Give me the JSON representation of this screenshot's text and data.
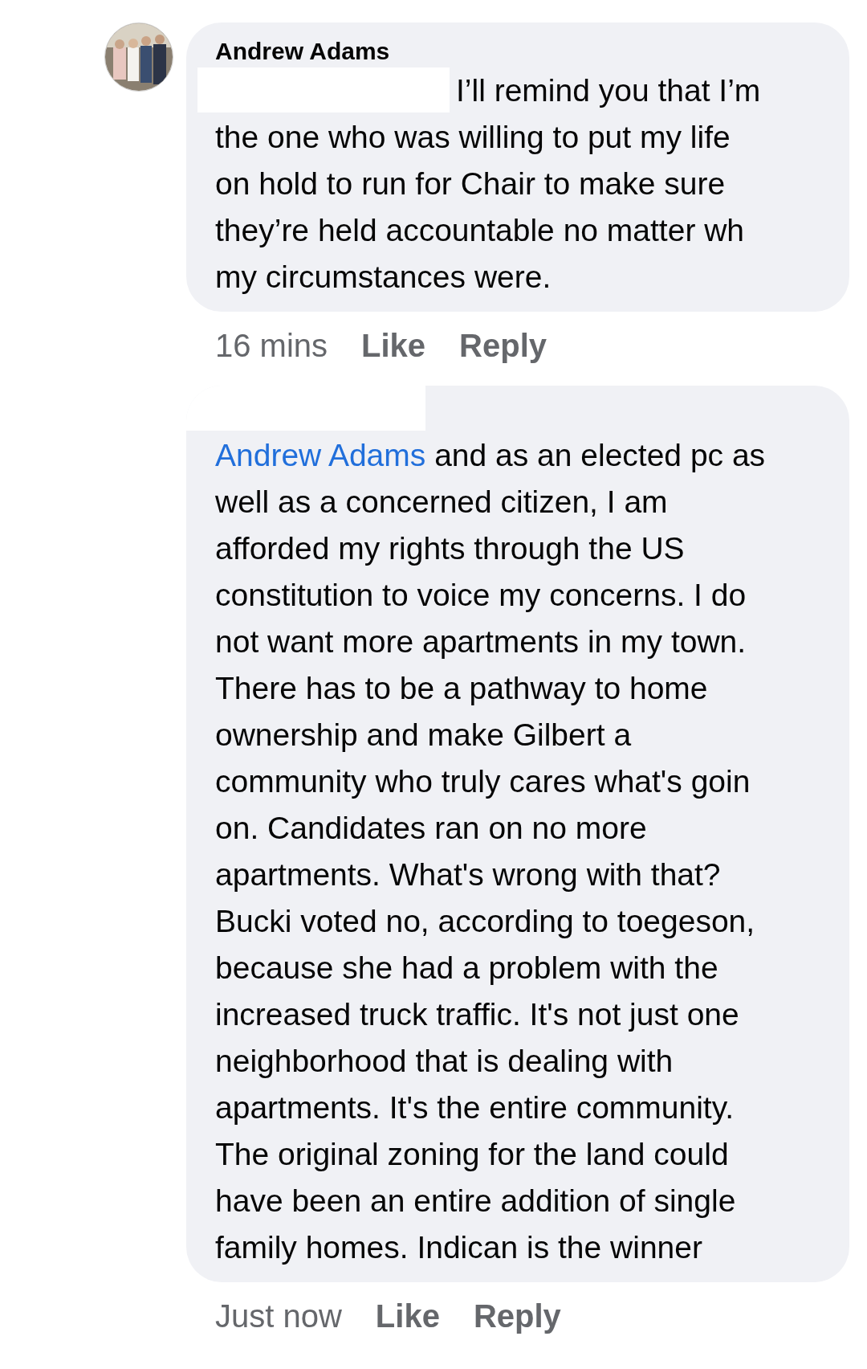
{
  "comments": [
    {
      "author": "Andrew Adams",
      "avatar": true,
      "redacted_start": true,
      "redacted_header": false,
      "lines": [
        "I’ll remind you that I’m",
        "the one who was willing to put my life",
        "on hold to run for Chair to make sure",
        "they’re held accountable no matter wh",
        "my circumstances were."
      ],
      "time": "16 mins",
      "actions": [
        "Like",
        "Reply"
      ]
    },
    {
      "avatar": false,
      "redacted_start": false,
      "redacted_header": true,
      "mention": "Andrew Adams",
      "lines": [
        "and as an elected pc as",
        "well as a concerned citizen, I am",
        "afforded my rights through the US",
        "constitution to voice my concerns. I do",
        "not want more apartments in my town.",
        "There has to be a pathway to home",
        "ownership and make Gilbert a",
        "community who truly cares what's goin",
        "on. Candidates ran on no more",
        "apartments. What's wrong with that?",
        "Bucki voted no, according to toegeson,",
        "because she had a problem with the",
        "increased truck traffic. It's not just one",
        "neighborhood that is dealing with",
        "apartments. It's the entire community.",
        "The original zoning for the land could",
        "have been an entire addition of single",
        "family homes. Indican is the winner"
      ],
      "time": "Just now",
      "actions": [
        "Like",
        "Reply"
      ]
    }
  ]
}
